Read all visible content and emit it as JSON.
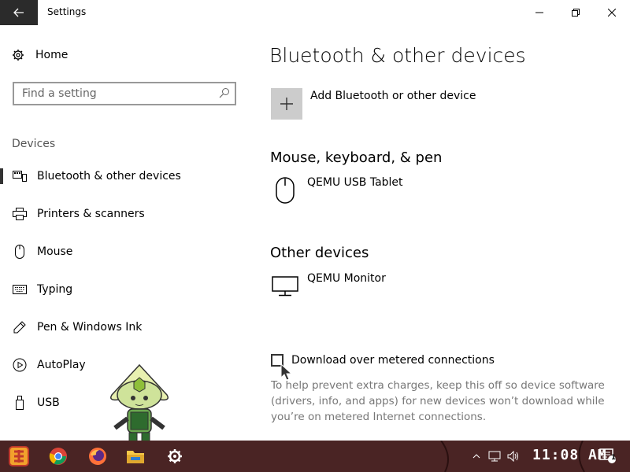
{
  "window": {
    "title": "Settings"
  },
  "sidebar": {
    "home_label": "Home",
    "search_placeholder": "Find a setting",
    "group_title": "Devices",
    "items": [
      {
        "label": "Bluetooth & other devices",
        "icon": "bluetooth-devices-icon",
        "selected": true
      },
      {
        "label": "Printers & scanners",
        "icon": "printer-icon"
      },
      {
        "label": "Mouse",
        "icon": "mouse-icon"
      },
      {
        "label": "Typing",
        "icon": "keyboard-icon"
      },
      {
        "label": "Pen & Windows Ink",
        "icon": "pen-icon"
      },
      {
        "label": "AutoPlay",
        "icon": "autoplay-icon"
      },
      {
        "label": "USB",
        "icon": "usb-icon"
      }
    ]
  },
  "main": {
    "title": "Bluetooth & other devices",
    "add_device_label": "Add Bluetooth or other device",
    "sections": [
      {
        "title": "Mouse, keyboard, & pen",
        "devices": [
          {
            "name": "QEMU USB Tablet",
            "icon": "mouse-icon"
          }
        ]
      },
      {
        "title": "Other devices",
        "devices": [
          {
            "name": "QEMU Monitor",
            "icon": "monitor-icon"
          }
        ]
      }
    ],
    "metered": {
      "label": "Download over metered connections",
      "checked": false,
      "help": "To help prevent extra charges, keep this off so device software (drivers, info, and apps) for new devices won’t download while you’re on metered Internet connections."
    }
  },
  "taskbar": {
    "apps": [
      "start-icon",
      "chrome-icon",
      "firefox-icon",
      "file-explorer-icon",
      "settings-gear-icon"
    ],
    "clock": "11:08 AM",
    "notification_count": "1"
  },
  "colors": {
    "taskbar": "#4a2424",
    "selected_bar": "#333333",
    "back_button": "#2b2b2b"
  }
}
